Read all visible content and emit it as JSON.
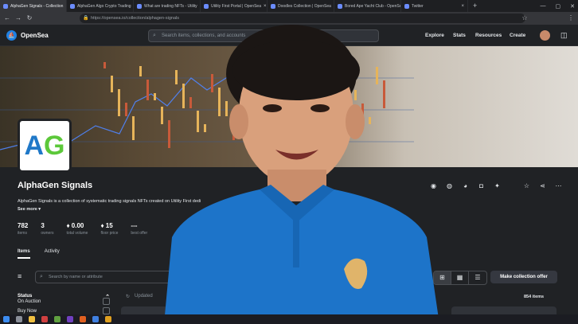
{
  "browser": {
    "tabs": [
      {
        "title": "AlphaGen Signals - Collection",
        "active": true
      },
      {
        "title": "AlphaGen Algo Crypto Trading",
        "active": false
      },
      {
        "title": "What are trading NFTs - Utility",
        "active": false
      },
      {
        "title": "Utility First Portal | OpenSea",
        "active": false
      },
      {
        "title": "Doodles Collection | OpenSea",
        "active": false
      },
      {
        "title": "Bored Ape Yacht Club - OpenSea",
        "active": false
      },
      {
        "title": "Twitter",
        "active": false
      }
    ],
    "new_tab_label": "+",
    "url": "https://opensea.io/collection/alphagen-signals"
  },
  "header": {
    "logo_text": "OpenSea",
    "search_placeholder": "Search items, collections, and accounts",
    "nav": [
      "Explore",
      "Stats",
      "Resources",
      "Create"
    ]
  },
  "collection": {
    "avatar_text_a": "A",
    "avatar_text_g": "G",
    "name": "AlphaGen Signals",
    "description": "AlphaGen Signals is a collection of systematic trading signals NFTs created on Utility First dedi",
    "see_more": "See more ▾",
    "stats": [
      {
        "value": "782",
        "label": "items"
      },
      {
        "value": "3",
        "label": "owners"
      },
      {
        "value": "♦ 0.00",
        "label": "total volume"
      },
      {
        "value": "♦ 15",
        "label": "floor price"
      },
      {
        "value": "---",
        "label": "best offer"
      }
    ]
  },
  "page_tabs": [
    "Items",
    "Activity"
  ],
  "filters": {
    "search_placeholder": "Search by name or attribute",
    "collection_offer_label": "Make collection offer",
    "status_title": "Status",
    "status_options": [
      "Buy Now",
      "On Auction"
    ],
    "updated_label": "Updated",
    "item_count": "854 items"
  },
  "colors": {
    "opensea_blue": "#2081e2",
    "ag_a": "#1f78c8",
    "ag_g": "#5cc83a",
    "shirt": "#1d74c9"
  }
}
